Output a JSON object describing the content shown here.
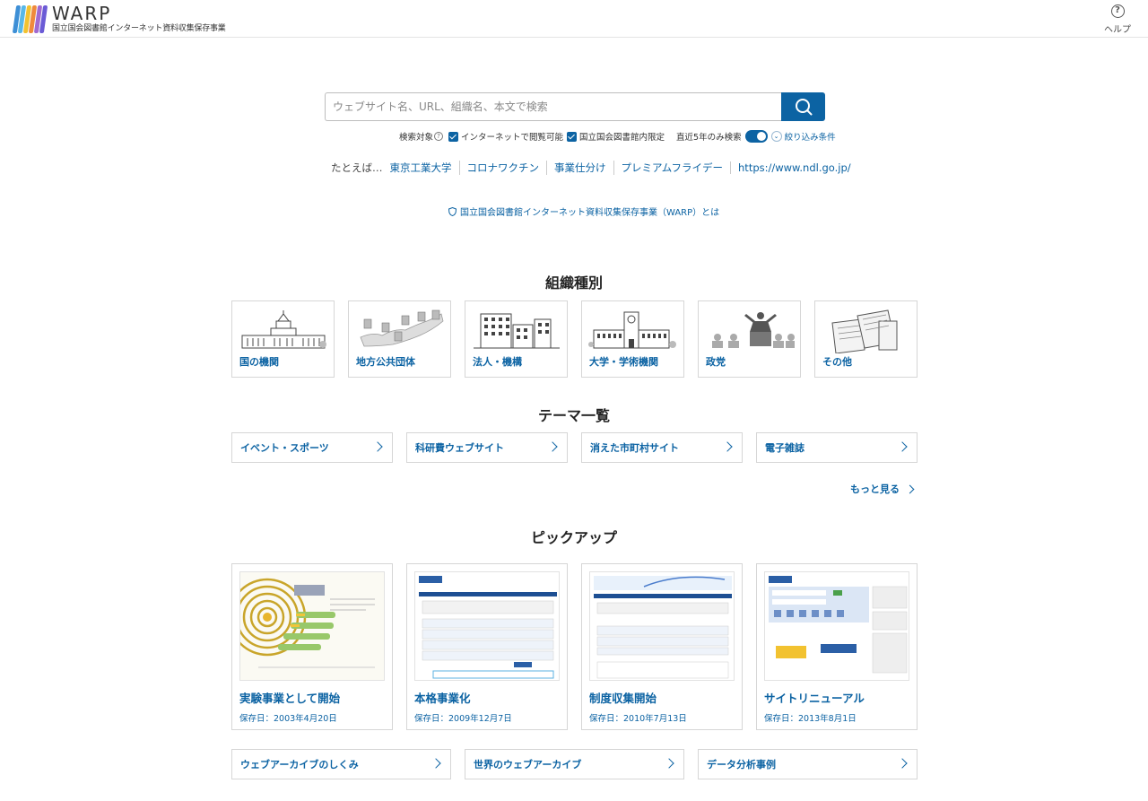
{
  "header": {
    "logo_word": "WARP",
    "logo_sub": "国立国会図書館インターネット資料収集保存事業",
    "help_label": "ヘルプ"
  },
  "search": {
    "placeholder": "ウェブサイト名、URL、組織名、本文で検索",
    "target_label": "検索対象",
    "option_internet": "インターネットで閲覧可能",
    "option_ndl": "国立国会図書館内限定",
    "recent_label": "直近5年のみ検索",
    "filter_label": "絞り込み条件"
  },
  "examples": {
    "lead": "たとえば…",
    "items": [
      "東京工業大学",
      "コロナワクチン",
      "事業仕分け",
      "プレミアムフライデー",
      "https://www.ndl.go.jp/"
    ]
  },
  "about_link": "国立国会図書館インターネット資料収集保存事業（WARP）とは",
  "org": {
    "title": "組織種別",
    "items": [
      "国の機関",
      "地方公共団体",
      "法人・機構",
      "大学・学術機関",
      "政党",
      "その他"
    ]
  },
  "themes": {
    "title": "テーマ一覧",
    "items": [
      "イベント・スポーツ",
      "科研費ウェブサイト",
      "消えた市町村サイト",
      "電子雑誌"
    ],
    "more": "もっと見る"
  },
  "pickup": {
    "title": "ピックアップ",
    "items": [
      {
        "title": "実験事業として開始",
        "date": "保存日：2003年4月20日"
      },
      {
        "title": "本格事業化",
        "date": "保存日：2009年12月7日"
      },
      {
        "title": "制度収集開始",
        "date": "保存日：2010年7月13日"
      },
      {
        "title": "サイトリニューアル",
        "date": "保存日：2013年8月1日"
      }
    ]
  },
  "footer_links": [
    "ウェブアーカイブのしくみ",
    "世界のウェブアーカイブ",
    "データ分析事例"
  ],
  "colors": {
    "accent": "#0c63a3",
    "border": "#d6d6d6"
  }
}
